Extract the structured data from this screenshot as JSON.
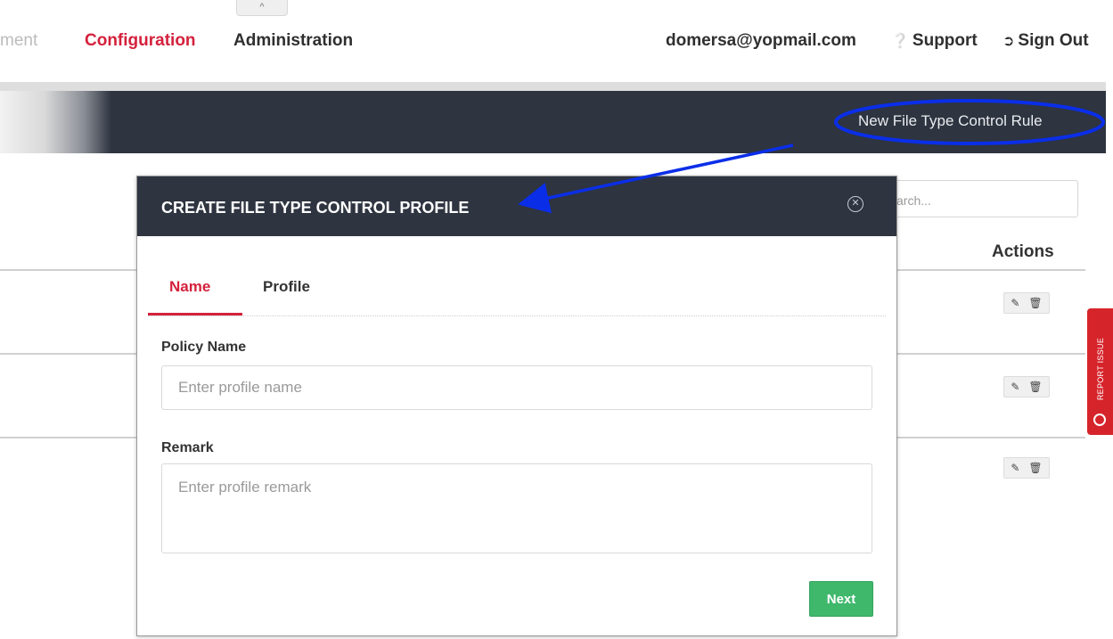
{
  "topnav": {
    "collapse_glyph": "^",
    "faded_item": "ment",
    "items": [
      {
        "label": "Configuration",
        "active": true
      },
      {
        "label": "Administration",
        "active": false
      }
    ],
    "user_email": "domersa@yopmail.com",
    "support_label": "Support",
    "support_icon": "question-circle-icon",
    "signout_label": "Sign Out",
    "signout_icon": "sign-out-icon"
  },
  "header_bar": {
    "new_rule_link": "New File Type Control Rule"
  },
  "table": {
    "search_placeholder": "arch...",
    "actions_header": "Actions",
    "row_actions": [
      "edit-icon",
      "delete-icon"
    ],
    "row_count": 3
  },
  "report_issue": {
    "label": "REPORT ISSUE"
  },
  "modal": {
    "title": "CREATE FILE TYPE CONTROL PROFILE",
    "close_icon": "close-circle-icon",
    "tabs": [
      {
        "label": "Name",
        "active": true
      },
      {
        "label": "Profile",
        "active": false
      }
    ],
    "policy_name": {
      "label": "Policy Name",
      "placeholder": "Enter profile name",
      "value": ""
    },
    "remark": {
      "label": "Remark",
      "placeholder": "Enter profile remark",
      "value": ""
    },
    "next_label": "Next"
  },
  "colors": {
    "accent_red": "#d4213c",
    "dark_header": "#2e3440",
    "next_green": "#3fb86c",
    "annotation_blue": "#0a2ee8",
    "report_red": "#d6242b"
  }
}
